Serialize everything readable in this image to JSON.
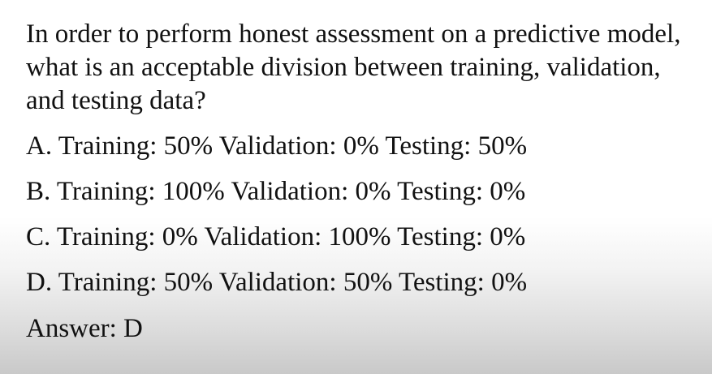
{
  "question": "In order to perform honest assessment on a predictive model, what is an acceptable division between training, validation, and testing data?",
  "options": [
    "A. Training: 50% Validation: 0% Testing: 50%",
    "B. Training: 100% Validation: 0% Testing: 0%",
    "C. Training: 0% Validation: 100% Testing: 0%",
    "D. Training: 50% Validation: 50% Testing: 0%"
  ],
  "answer": "Answer: D"
}
